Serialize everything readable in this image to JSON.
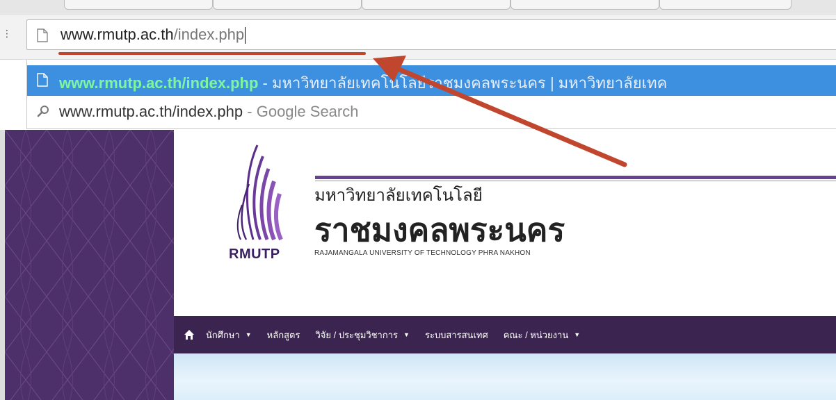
{
  "omnibox": {
    "host": "www.rmutp.ac.th",
    "path": "/index.php"
  },
  "suggestions": [
    {
      "url": "www.rmutp.ac.th/index.php",
      "separator": "-",
      "description": "มหาวิทยาลัยเทคโนโลยีราชมงคลพระนคร | มหาวิทยาลัยเทค",
      "icon": "page-icon"
    },
    {
      "url": "www.rmutp.ac.th/index.php",
      "separator": "-",
      "description": "Google Search",
      "icon": "search-icon"
    }
  ],
  "site": {
    "logo_text": "RMUTP",
    "university_line1": "มหาวิทยาลัยเทคโนโลยี",
    "university_line2": "ราชมงคลพระนคร",
    "university_english": "RAJAMANGALA UNIVERSITY OF TECHNOLOGY PHRA NAKHON",
    "nav": [
      {
        "label": "นักศึกษา",
        "has_dropdown": true
      },
      {
        "label": "หลักสูตร",
        "has_dropdown": false
      },
      {
        "label": "วิจัย / ประชุมวิชาการ",
        "has_dropdown": true
      },
      {
        "label": "ระบบสารสนเทศ",
        "has_dropdown": false
      },
      {
        "label": "คณะ / หน่วยงาน",
        "has_dropdown": true
      }
    ]
  },
  "colors": {
    "suggest_highlight": "#3d8fe0",
    "suggest_url": "#7ef5a0",
    "brand_purple": "#4d2f6a",
    "navbar": "#3c2450",
    "annotation": "#c0462e"
  }
}
